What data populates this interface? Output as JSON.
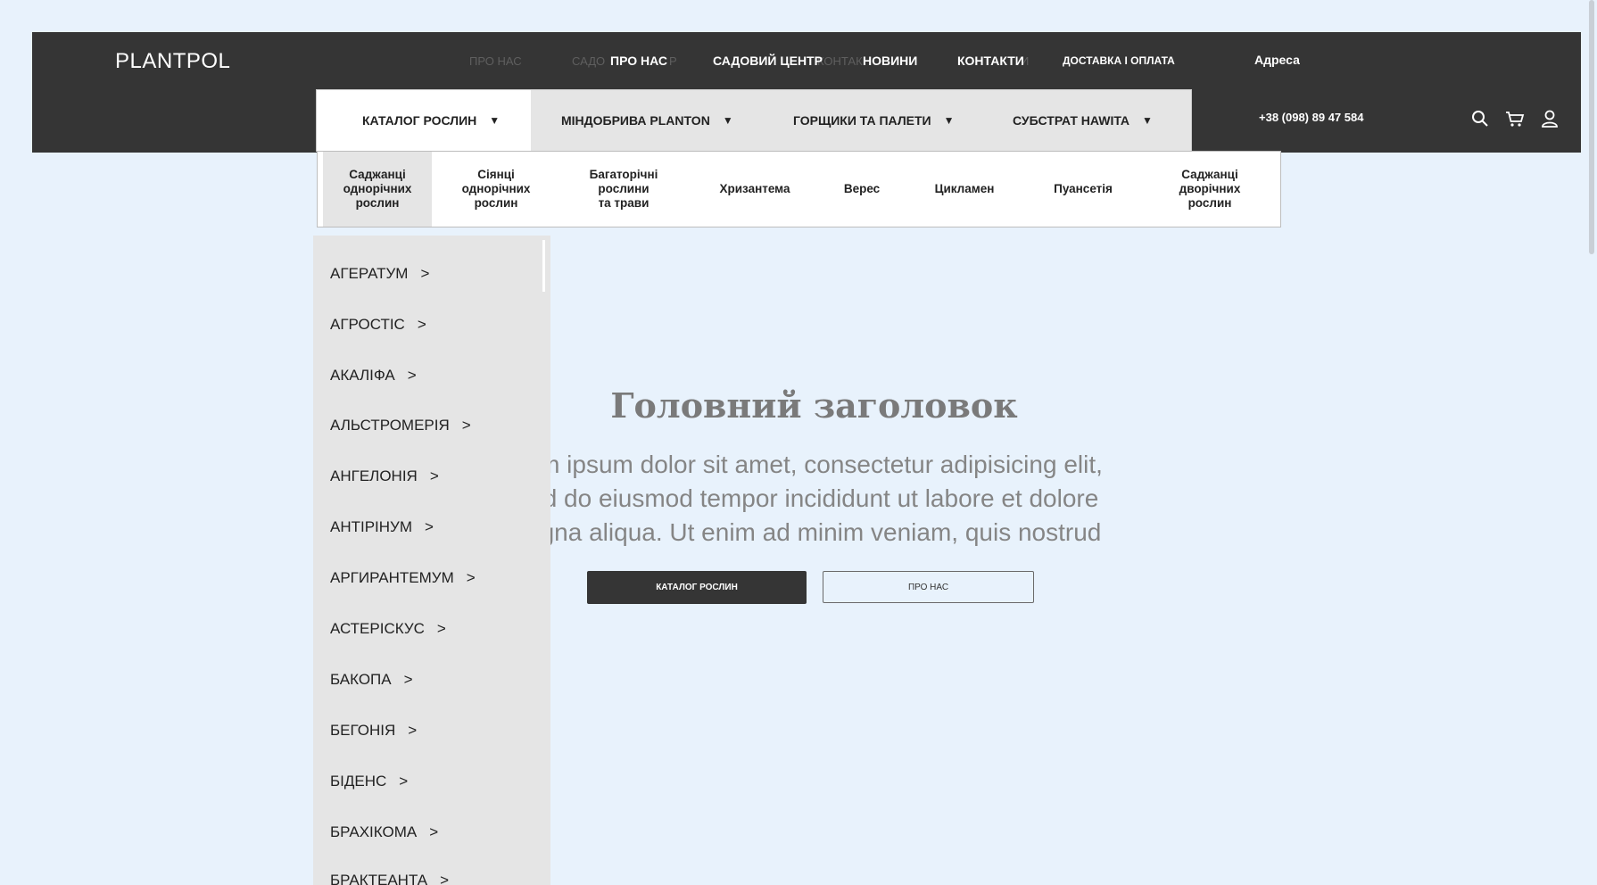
{
  "header": {
    "logo": "PLANTPOL",
    "ghost_nav": [
      "ПРО НАС",
      "САДО",
      "Р",
      "КОНТАК",
      "И"
    ],
    "nav": [
      "ПРО НАС",
      "САДОВИЙ ЦЕНТР",
      "НОВИНИ",
      "КОНТАКТИ",
      "ДОСТАВКА І ОПЛАТА"
    ],
    "address": "Адреса",
    "phone": "+38 (098) 89 47 584",
    "icons": [
      "search-icon",
      "cart-icon",
      "user-icon"
    ]
  },
  "categories": {
    "tabs": [
      {
        "label": "КАТАЛОГ РОСЛИН",
        "caret": "▼"
      },
      {
        "label": "МІНДОБРИВА PLANTON",
        "caret": "▼"
      },
      {
        "label": "ГОРЩИКИ ТА ПАЛЕТИ",
        "caret": "▼"
      },
      {
        "label": "СУБСТРАТ HAWITA",
        "caret": "▼"
      }
    ]
  },
  "subcategories": {
    "items": [
      [
        "Саджанці",
        "однорічних",
        "рослин"
      ],
      [
        "Сіянці",
        "однорічних",
        "рослин"
      ],
      [
        "Багаторічні",
        "рослини",
        "та трави"
      ],
      [
        "Хризантема"
      ],
      [
        "Верес"
      ],
      [
        "Цикламен"
      ],
      [
        "Пуансетія"
      ],
      [
        "Саджанці",
        "дворічних",
        "рослин"
      ]
    ]
  },
  "plants": {
    "arrow": ">",
    "items": [
      "АГЕРАТУМ",
      "АГРОСТІС",
      "АКАЛІФА",
      "АЛЬСТРОМЕРІЯ",
      "АНГЕЛОНІЯ",
      "АНТІРІНУМ",
      "АРГИРАНТЕМУМ",
      "АСТЕРІСКУС",
      "БАКОПА",
      "БЕГОНІЯ",
      "БІДЕНС",
      "БРАХІКОМА",
      "БРАКТЕАНТА"
    ]
  },
  "hero": {
    "title": "Головний заголовок",
    "text_lines": [
      "m ipsum dolor sit amet, consectetur adipisicing elit,",
      "d do eiusmod tempor incididunt ut labore et dolore",
      "gna aliqua. Ut enim ad minim veniam, quis nostrud"
    ],
    "primary_button": "КАТАЛОГ РОСЛИН",
    "secondary_button": "ПРО НАС"
  },
  "colors": {
    "background": "#e8f2fc",
    "header": "#353535",
    "panel": "#e5e5e5"
  }
}
